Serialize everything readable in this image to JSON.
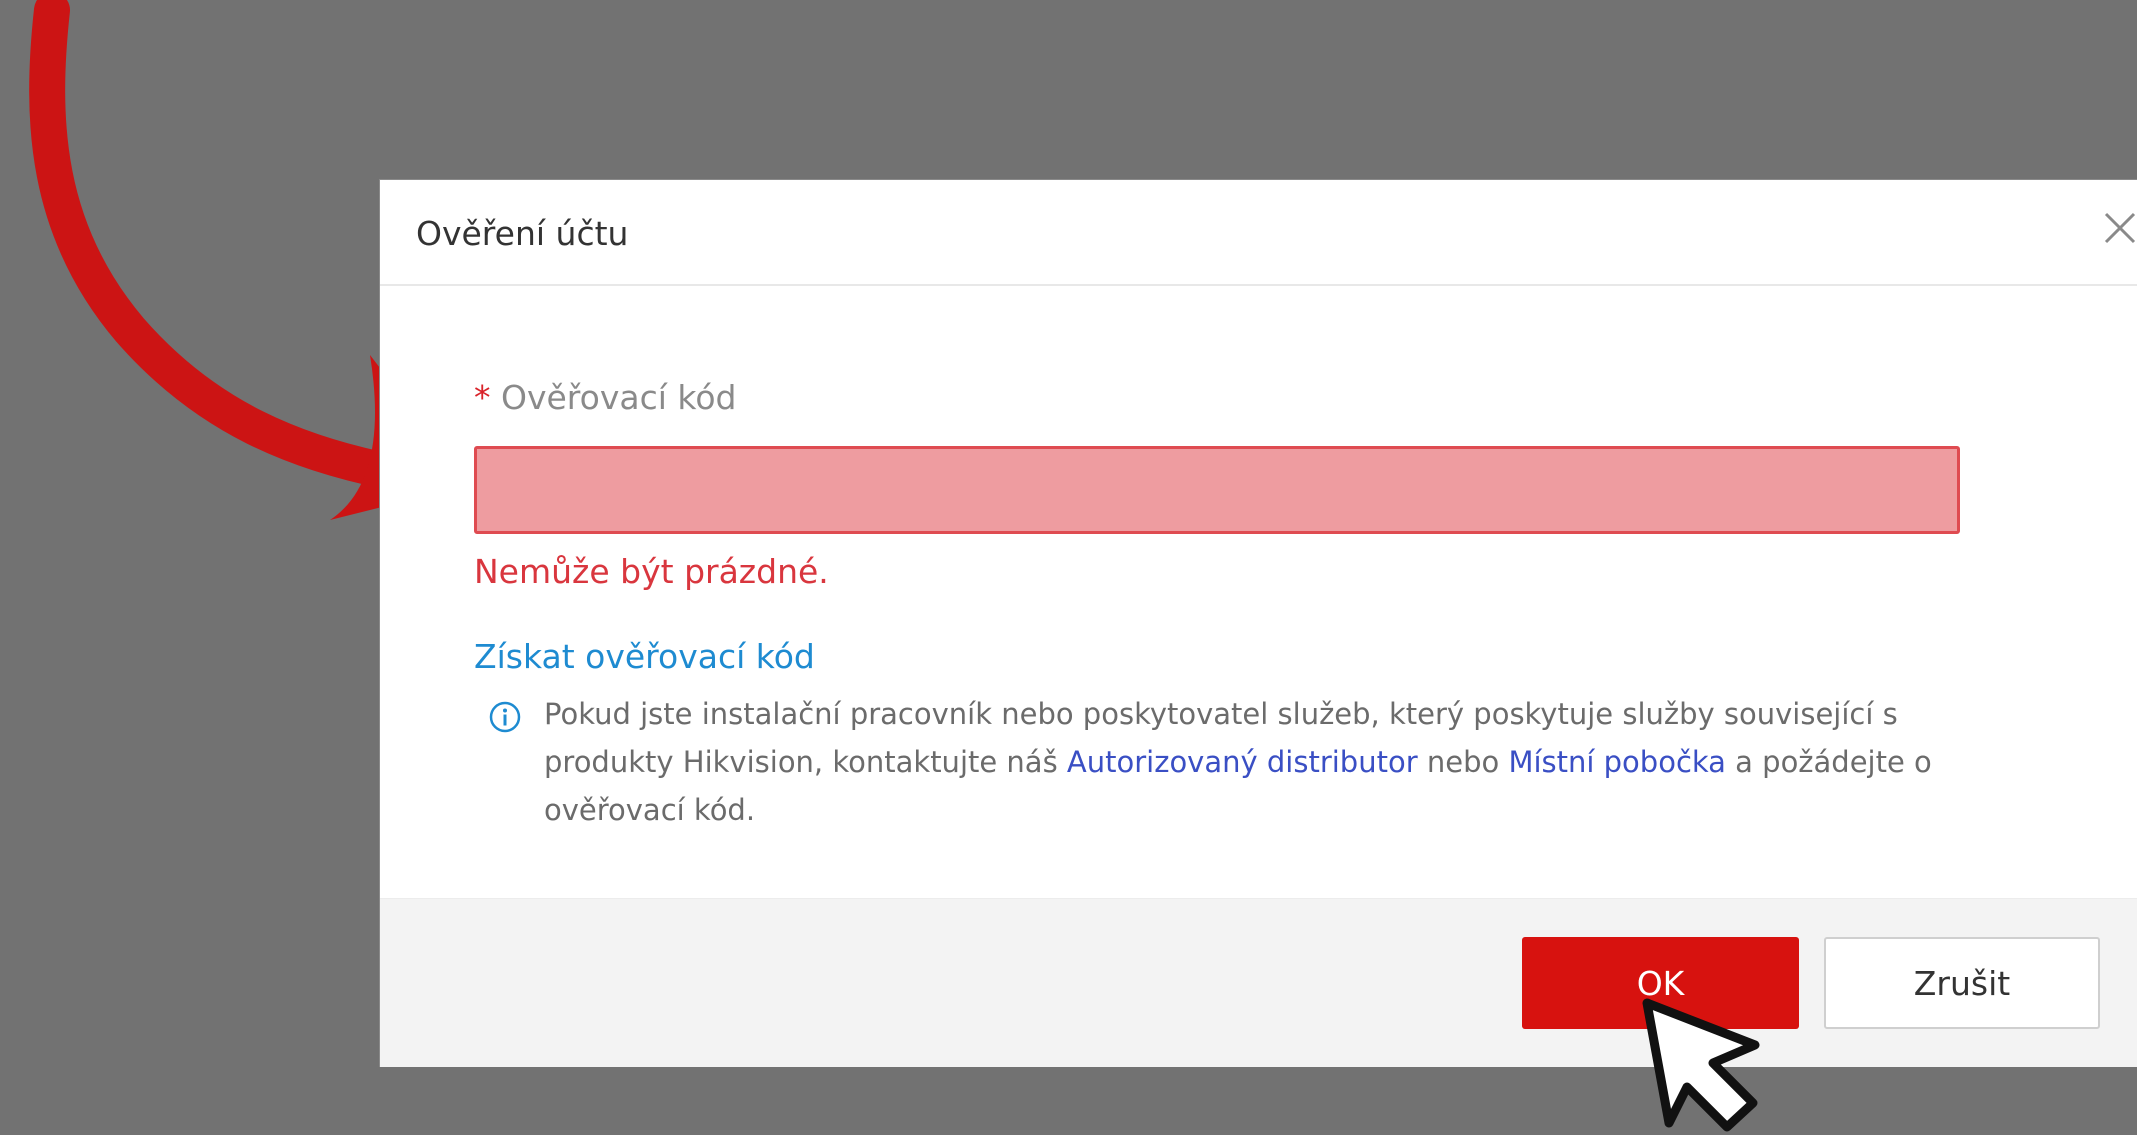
{
  "dialog": {
    "title": "Ověření účtu",
    "close_icon": "close-icon"
  },
  "form": {
    "required_marker": "*",
    "field_label": "Ověřovací kód",
    "input_value": "",
    "input_placeholder": "",
    "error_message": "Nemůže být prázdné.",
    "get_code_link": "Získat ověřovací kód"
  },
  "info": {
    "icon": "info-icon",
    "text_part1": "Pokud jste instalační pracovník nebo poskytovatel služeb, který poskytuje služby související s produkty Hikvision, kontaktujte náš ",
    "link_distributor": "Autorizovaný distributor",
    "text_part2": " nebo ",
    "link_branch": "Místní pobočka",
    "text_part3": " a požádejte o ověřovací kód."
  },
  "footer": {
    "ok_label": "OK",
    "cancel_label": "Zrušit"
  },
  "colors": {
    "background": "#727272",
    "accent_red": "#d7120f",
    "error_red": "#d9363e",
    "link_blue": "#1e8bd1",
    "info_link_blue": "#3a4fc4"
  },
  "overlays": {
    "arrow": "red-arrow-icon",
    "cursor": "pointer-cursor-icon"
  }
}
